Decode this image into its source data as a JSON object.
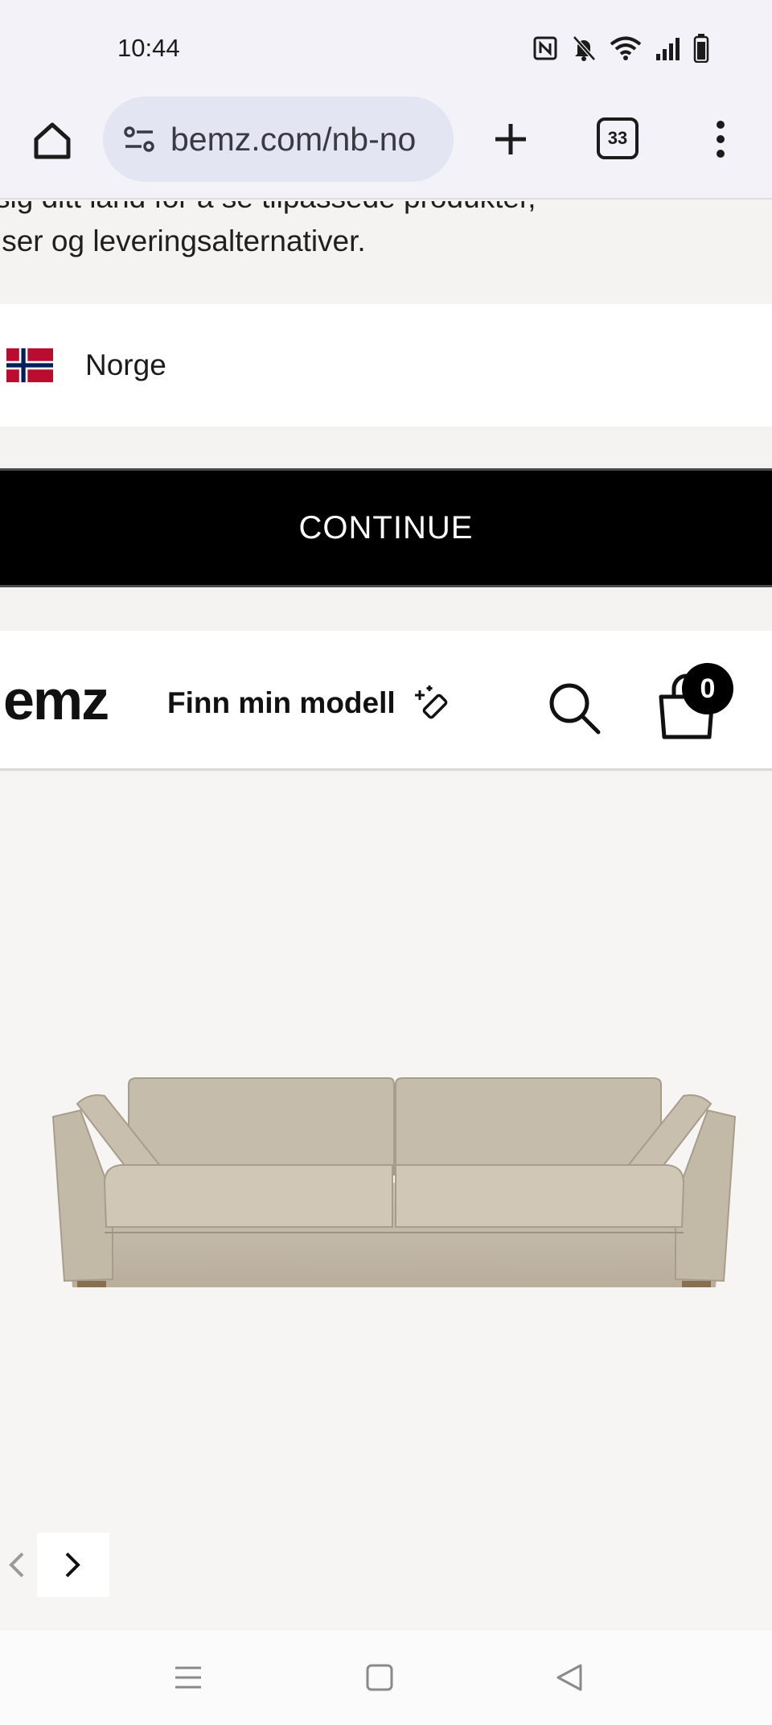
{
  "status_bar": {
    "time": "10:44",
    "icons": [
      "nfc-icon",
      "bell-muted-icon",
      "wifi-icon",
      "signal-icon",
      "battery-icon"
    ]
  },
  "browser": {
    "url": "bemz.com/nb-no",
    "tab_count": "33",
    "icons": [
      "home-icon",
      "site-settings-icon",
      "new-tab-icon",
      "tab-switcher-icon",
      "overflow-menu-icon"
    ]
  },
  "country_banner": {
    "description_line1": "sig ditt land for å se tilpassede produkter,",
    "description_line2": "iser og leveringsalternativer.",
    "country": "Norge",
    "continue_label": "CONTINUE"
  },
  "site_header": {
    "logo": "emz",
    "find_model_label": "Finn min modell",
    "cart_count": "0"
  },
  "colors": {
    "accent": "#000000",
    "background": "#f4f3f1",
    "browser_bar": "#f3f2f9",
    "url_pill": "#e3e5f3"
  }
}
